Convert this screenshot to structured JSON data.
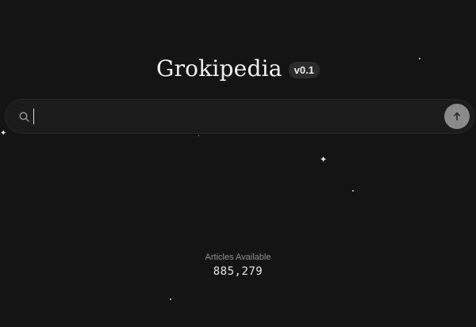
{
  "header": {
    "logo_text": "Grokipedia",
    "version_label": "v0.1"
  },
  "search": {
    "value": "",
    "placeholder": "",
    "icon": "search-icon",
    "submit_icon": "arrow-up-icon"
  },
  "stats": {
    "label": "Articles Available",
    "value": "885,279"
  },
  "colors": {
    "background": "#141414",
    "search_bg": "#1c1c1c",
    "submit_bg": "#8a8a8a",
    "muted_text": "#8f8f8f"
  }
}
